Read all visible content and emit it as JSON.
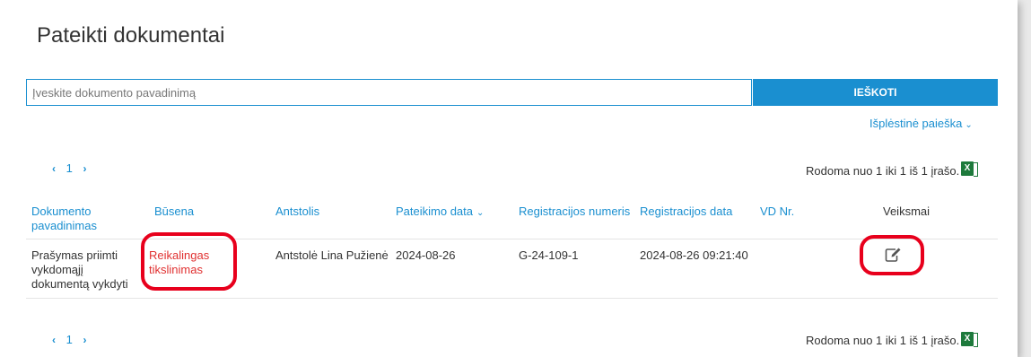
{
  "page": {
    "title": "Pateikti dokumentai"
  },
  "search": {
    "placeholder": "Įveskite dokumento pavadinimą",
    "button_label": "IEŠKOTI",
    "advanced_label": "Išplėstinė paieška"
  },
  "pager_top": {
    "prev": "‹",
    "page": "1",
    "next": "›",
    "count_text": "Rodoma nuo 1 iki 1 iš 1 įrašo."
  },
  "pager_bottom": {
    "prev": "‹",
    "page": "1",
    "next": "›",
    "count_text": "Rodoma nuo 1 iki 1 iš 1 įrašo."
  },
  "table": {
    "headers": {
      "doc_name_1": "Dokumento",
      "doc_name_2": "pavadinimas",
      "status": "Būsena",
      "bailiff": "Antstolis",
      "submit_date": "Pateikimo data",
      "reg_number": "Registracijos numeris",
      "reg_date": "Registracijos data",
      "vd_nr": "VD Nr.",
      "actions": "Veiksmai"
    },
    "rows": [
      {
        "doc_name_1": "Prašymas priimti",
        "doc_name_2": "vykdomąjį",
        "doc_name_3": "dokumentą vykdyti",
        "status_1": "Reikalingas",
        "status_2": "tikslinimas",
        "bailiff": "Antstolė Lina Pužienė",
        "submit_date": "2024-08-26",
        "reg_number": "G-24-109-1",
        "reg_date": "2024-08-26 09:21:40",
        "vd_nr": ""
      }
    ]
  },
  "icons": {
    "export": "excel-export-icon",
    "edit": "edit-icon"
  },
  "colors": {
    "accent": "#1a8fd0",
    "status_red": "#e03030",
    "highlight": "#e8001c",
    "excel_green": "#1e7a3c"
  }
}
